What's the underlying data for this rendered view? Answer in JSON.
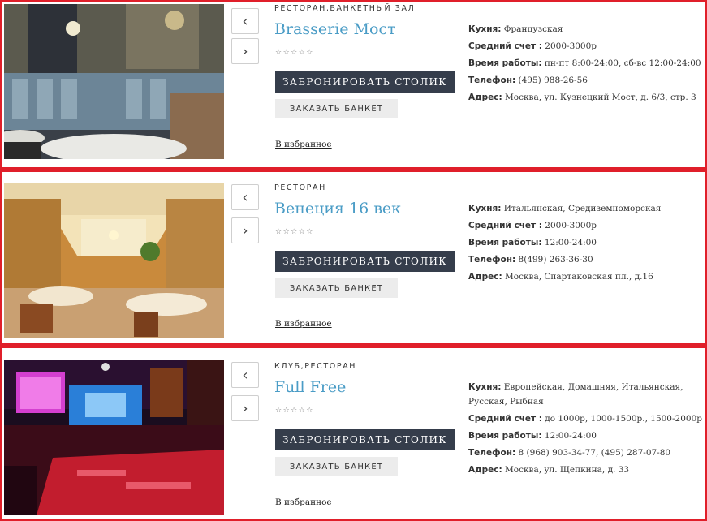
{
  "listings": [
    {
      "type": "РЕСТОРАН,БАНКЕТНЫЙ ЗАЛ",
      "name": "Brasserie Мост",
      "stars": "☆☆☆☆☆",
      "book_label": "ЗАБРОНИРОВАТЬ СТОЛИК",
      "banquet_label": "ЗАКАЗАТЬ БАНКЕТ",
      "fav_label": "В избранное",
      "cuisine_label": "Кухня:",
      "cuisine": "Французская",
      "check_label": "Средний счет :",
      "check": "2000-3000р",
      "hours_label": "Время работы:",
      "hours": "пн-пт 8:00-24:00, сб-вс 12:00-24:00",
      "phone_label": "Телефон:",
      "phone": "(495) 988-26-56",
      "address_label": "Адрес:",
      "address": "Москва, ул. Кузнецкий Мост, д. 6/3, стр. 3"
    },
    {
      "type": "РЕСТОРАН",
      "name": "Венеция 16 век",
      "stars": "☆☆☆☆☆",
      "book_label": "ЗАБРОНИРОВАТЬ СТОЛИК",
      "banquet_label": "ЗАКАЗАТЬ БАНКЕТ",
      "fav_label": "В избранное",
      "cuisine_label": "Кухня:",
      "cuisine": "Итальянская, Средиземноморская",
      "check_label": "Средний счет :",
      "check": "2000-3000р",
      "hours_label": "Время работы:",
      "hours": "12:00-24:00",
      "phone_label": "Телефон:",
      "phone": "8(499) 263-36-30",
      "address_label": "Адрес:",
      "address": "Москва, Спартаковская пл., д.16"
    },
    {
      "type": "КЛУБ,РЕСТОРАН",
      "name": "Full Free",
      "stars": "☆☆☆☆☆",
      "book_label": "ЗАБРОНИРОВАТЬ СТОЛИК",
      "banquet_label": "ЗАКАЗАТЬ БАНКЕТ",
      "fav_label": "В избранное",
      "cuisine_label": "Кухня:",
      "cuisine": "Европейская, Домашняя, Итальянская, Русская, Рыбная",
      "check_label": "Средний счет :",
      "check": "до 1000р, 1000-1500р., 1500-2000р",
      "hours_label": "Время работы:",
      "hours": "12:00-24:00",
      "phone_label": "Телефон:",
      "phone": "8 (968) 903-34-77, (495) 287-07-80",
      "address_label": "Адрес:",
      "address": "Москва, ул. Щепкина, д. 33"
    }
  ],
  "nav": {
    "prev": "‹",
    "next": "›"
  },
  "colors": {
    "frame": "#e01f2a",
    "accent": "#4a9cc6",
    "book_button": "#353d4b",
    "banquet_button": "#ececec"
  }
}
